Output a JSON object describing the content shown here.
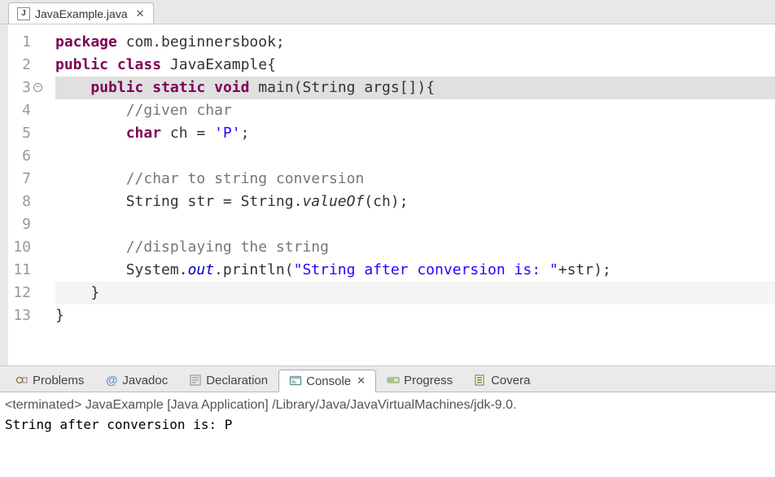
{
  "editorTab": {
    "title": "JavaExample.java",
    "iconLetter": "J"
  },
  "code": {
    "lines": [
      "package com.beginnersbook;",
      "public class JavaExample{",
      "    public static void main(String args[]){",
      "        //given char",
      "        char ch = 'P';",
      "",
      "        //char to string conversion",
      "        String str = String.valueOf(ch);",
      "",
      "        //displaying the string",
      "        System.out.println(\"String after conversion is: \"+str);",
      "    }",
      "}"
    ],
    "lineNumbers": [
      "1",
      "2",
      "3",
      "4",
      "5",
      "6",
      "7",
      "8",
      "9",
      "10",
      "11",
      "12",
      "13"
    ],
    "foldableLine": 3
  },
  "bottomTabs": {
    "problems": "Problems",
    "javadoc": "Javadoc",
    "javadocAt": "@",
    "declaration": "Declaration",
    "console": "Console",
    "progress": "Progress",
    "coverage": "Covera"
  },
  "console": {
    "status": "<terminated> JavaExample [Java Application] /Library/Java/JavaVirtualMachines/jdk-9.0.",
    "output": "String after conversion is: P"
  }
}
